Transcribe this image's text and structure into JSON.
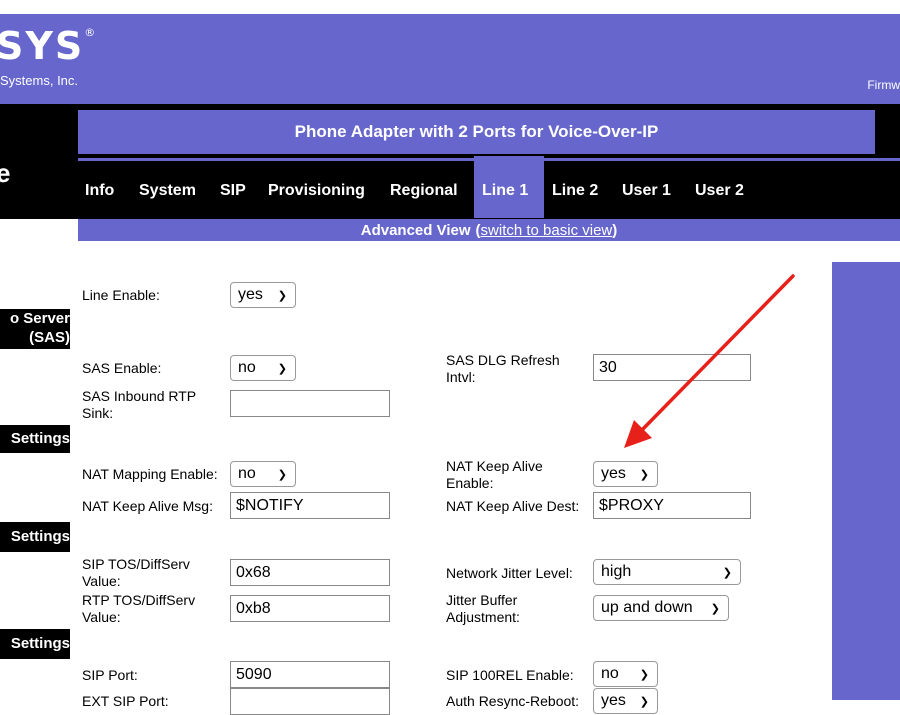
{
  "header": {
    "logo_text": "SYS",
    "logo_reg": "®",
    "logo_sub": "Systems, Inc.",
    "firmware": "Firmw",
    "left_big": "e",
    "title": "Phone Adapter with 2 Ports for Voice-Over-IP"
  },
  "tabs": [
    {
      "label": "Info"
    },
    {
      "label": "System"
    },
    {
      "label": "SIP"
    },
    {
      "label": "Provisioning"
    },
    {
      "label": "Regional"
    },
    {
      "label": "Line 1"
    },
    {
      "label": "Line 2"
    },
    {
      "label": "User 1"
    },
    {
      "label": "User 2"
    }
  ],
  "view": {
    "label": "Advanced View",
    "paren_open": "(",
    "link": "switch to basic view",
    "paren_close": ")"
  },
  "sidebar": {
    "sas_line1": "o Server",
    "sas_line2": "(SAS)",
    "s1": "Settings",
    "s2": "Settings",
    "s3": "Settings"
  },
  "form": {
    "line_enable": {
      "label": "Line Enable:",
      "value": "yes"
    },
    "sas_enable": {
      "label": "SAS Enable:",
      "value": "no"
    },
    "sas_dlg": {
      "label1": "SAS DLG Refresh",
      "label2": "Intvl:",
      "value": "30"
    },
    "sas_rtp": {
      "label1": "SAS Inbound RTP",
      "label2": "Sink:",
      "value": ""
    },
    "nat_mapping": {
      "label": "NAT Mapping Enable:",
      "value": "no"
    },
    "nat_keep_enable": {
      "label1": "NAT Keep Alive",
      "label2": "Enable:",
      "value": "yes"
    },
    "nat_keep_msg": {
      "label": "NAT Keep Alive Msg:",
      "value": "$NOTIFY"
    },
    "nat_keep_dest": {
      "label": "NAT Keep Alive Dest:",
      "value": "$PROXY"
    },
    "sip_tos": {
      "label1": "SIP TOS/DiffServ",
      "label2": "Value:",
      "value": "0x68"
    },
    "jitter_level": {
      "label": "Network Jitter Level:",
      "value": "high"
    },
    "rtp_tos": {
      "label1": "RTP TOS/DiffServ",
      "label2": "Value:",
      "value": "0xb8"
    },
    "jitter_adj": {
      "label1": "Jitter Buffer",
      "label2": "Adjustment:",
      "value": "up and down"
    },
    "sip_port": {
      "label": "SIP Port:",
      "value": "5090"
    },
    "sip_100rel": {
      "label": "SIP 100REL Enable:",
      "value": "no"
    },
    "ext_sip": {
      "label": "EXT SIP Port:",
      "value": ""
    },
    "auth_resync": {
      "label": "Auth Resync-Reboot:",
      "value": "yes"
    }
  },
  "annotation": {
    "arrow_color": "#e8201a"
  }
}
